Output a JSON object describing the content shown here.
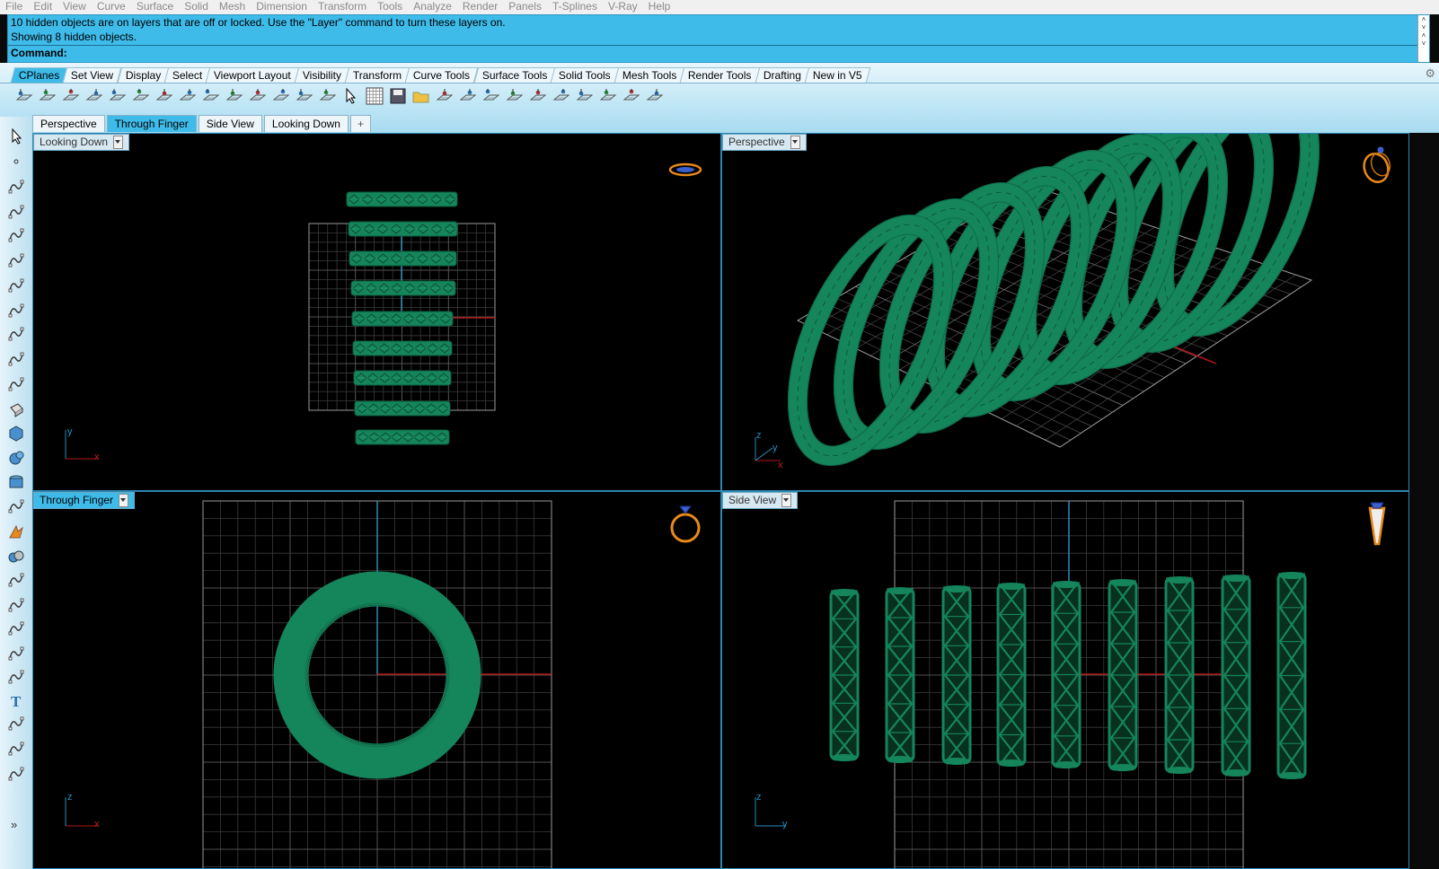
{
  "menu": [
    "File",
    "Edit",
    "View",
    "Curve",
    "Surface",
    "Solid",
    "Mesh",
    "Dimension",
    "Transform",
    "Tools",
    "Analyze",
    "Render",
    "Panels",
    "T-Splines",
    "V-Ray",
    "Help"
  ],
  "command": {
    "line1": "10 hidden objects are on layers that are off or locked.  Use the \"Layer\" command to turn these layers on.",
    "line2": "Showing 8 hidden objects.",
    "prompt": "Command:",
    "value": ""
  },
  "toolbar_tabs": [
    {
      "label": "CPlanes",
      "active": true
    },
    {
      "label": "Set View",
      "active": false
    },
    {
      "label": "Display",
      "active": false
    },
    {
      "label": "Select",
      "active": false
    },
    {
      "label": "Viewport Layout",
      "active": false
    },
    {
      "label": "Visibility",
      "active": false
    },
    {
      "label": "Transform",
      "active": false
    },
    {
      "label": "Curve Tools",
      "active": false
    },
    {
      "label": "Surface Tools",
      "active": false
    },
    {
      "label": "Solid Tools",
      "active": false
    },
    {
      "label": "Mesh Tools",
      "active": false
    },
    {
      "label": "Render Tools",
      "active": false
    },
    {
      "label": "Drafting",
      "active": false
    },
    {
      "label": "New in V5",
      "active": false
    }
  ],
  "view_tabs": [
    {
      "label": "Perspective",
      "active": false
    },
    {
      "label": "Through Finger",
      "active": true
    },
    {
      "label": "Side View",
      "active": false
    },
    {
      "label": "Looking Down",
      "active": false
    }
  ],
  "viewports": {
    "top_left": {
      "title": "Looking Down",
      "axes": [
        "y",
        "x"
      ]
    },
    "top_right": {
      "title": "Perspective",
      "axes": [
        "z",
        "y",
        "x"
      ]
    },
    "bottom_left": {
      "title": "Through Finger",
      "axes": [
        "z",
        "x"
      ]
    },
    "bottom_right": {
      "title": "Side View",
      "axes": [
        "z",
        "y"
      ]
    }
  },
  "colors": {
    "command_bg": "#3ebbe9",
    "mesh_green": "#15855c",
    "grid": "#5a5a5a",
    "axis_red": "#b01818",
    "axis_blue": "#2a8bb8",
    "icon_orange": "#e88a1a"
  },
  "icons": {
    "toolbar": [
      "cplane-world-top-icon",
      "cplane-world-front-icon",
      "cplane-world-right-icon",
      "cplane-world-back-icon",
      "cplane-world-left-icon",
      "cplane-world-bottom-icon",
      "cplane-origin-icon",
      "cplane-elevation-icon",
      "cplane-3-points-icon",
      "cplane-x-axis-icon",
      "cplane-z-axis-icon",
      "cplane-view-icon",
      "cplane-object-icon",
      "undo-cplane-icon",
      "select-cursor-icon",
      "grid-icon",
      "save-cplane-icon",
      "open-cplane-icon",
      "rotate-cplane-icon",
      "cplane-curve-icon",
      "set-elevation-icon",
      "cplane-perpendicular-icon",
      "cplane-surface-icon",
      "cplane-up-icon",
      "cplane-previous-icon",
      "cplane-next-icon",
      "cplane-tools-icon",
      "named-cplanes-icon"
    ],
    "left": [
      "select-arrow-icon",
      "point-icon",
      "polyline-icon",
      "curve-icon",
      "circle-icon",
      "ellipse-icon",
      "polygon-icon",
      "rectangle-icon",
      "arc-icon",
      "fillet-icon",
      "surface-icon",
      "extrude-icon",
      "box-icon",
      "sphere-icon",
      "cylinder-icon",
      "plane-icon",
      "transform-icon",
      "boolean-icon",
      "split-icon",
      "trim-icon",
      "join-icon",
      "explode-icon",
      "array-icon",
      "text-icon",
      "dimension-icon",
      "group-icon",
      "layers-icon",
      "more-icon"
    ]
  }
}
